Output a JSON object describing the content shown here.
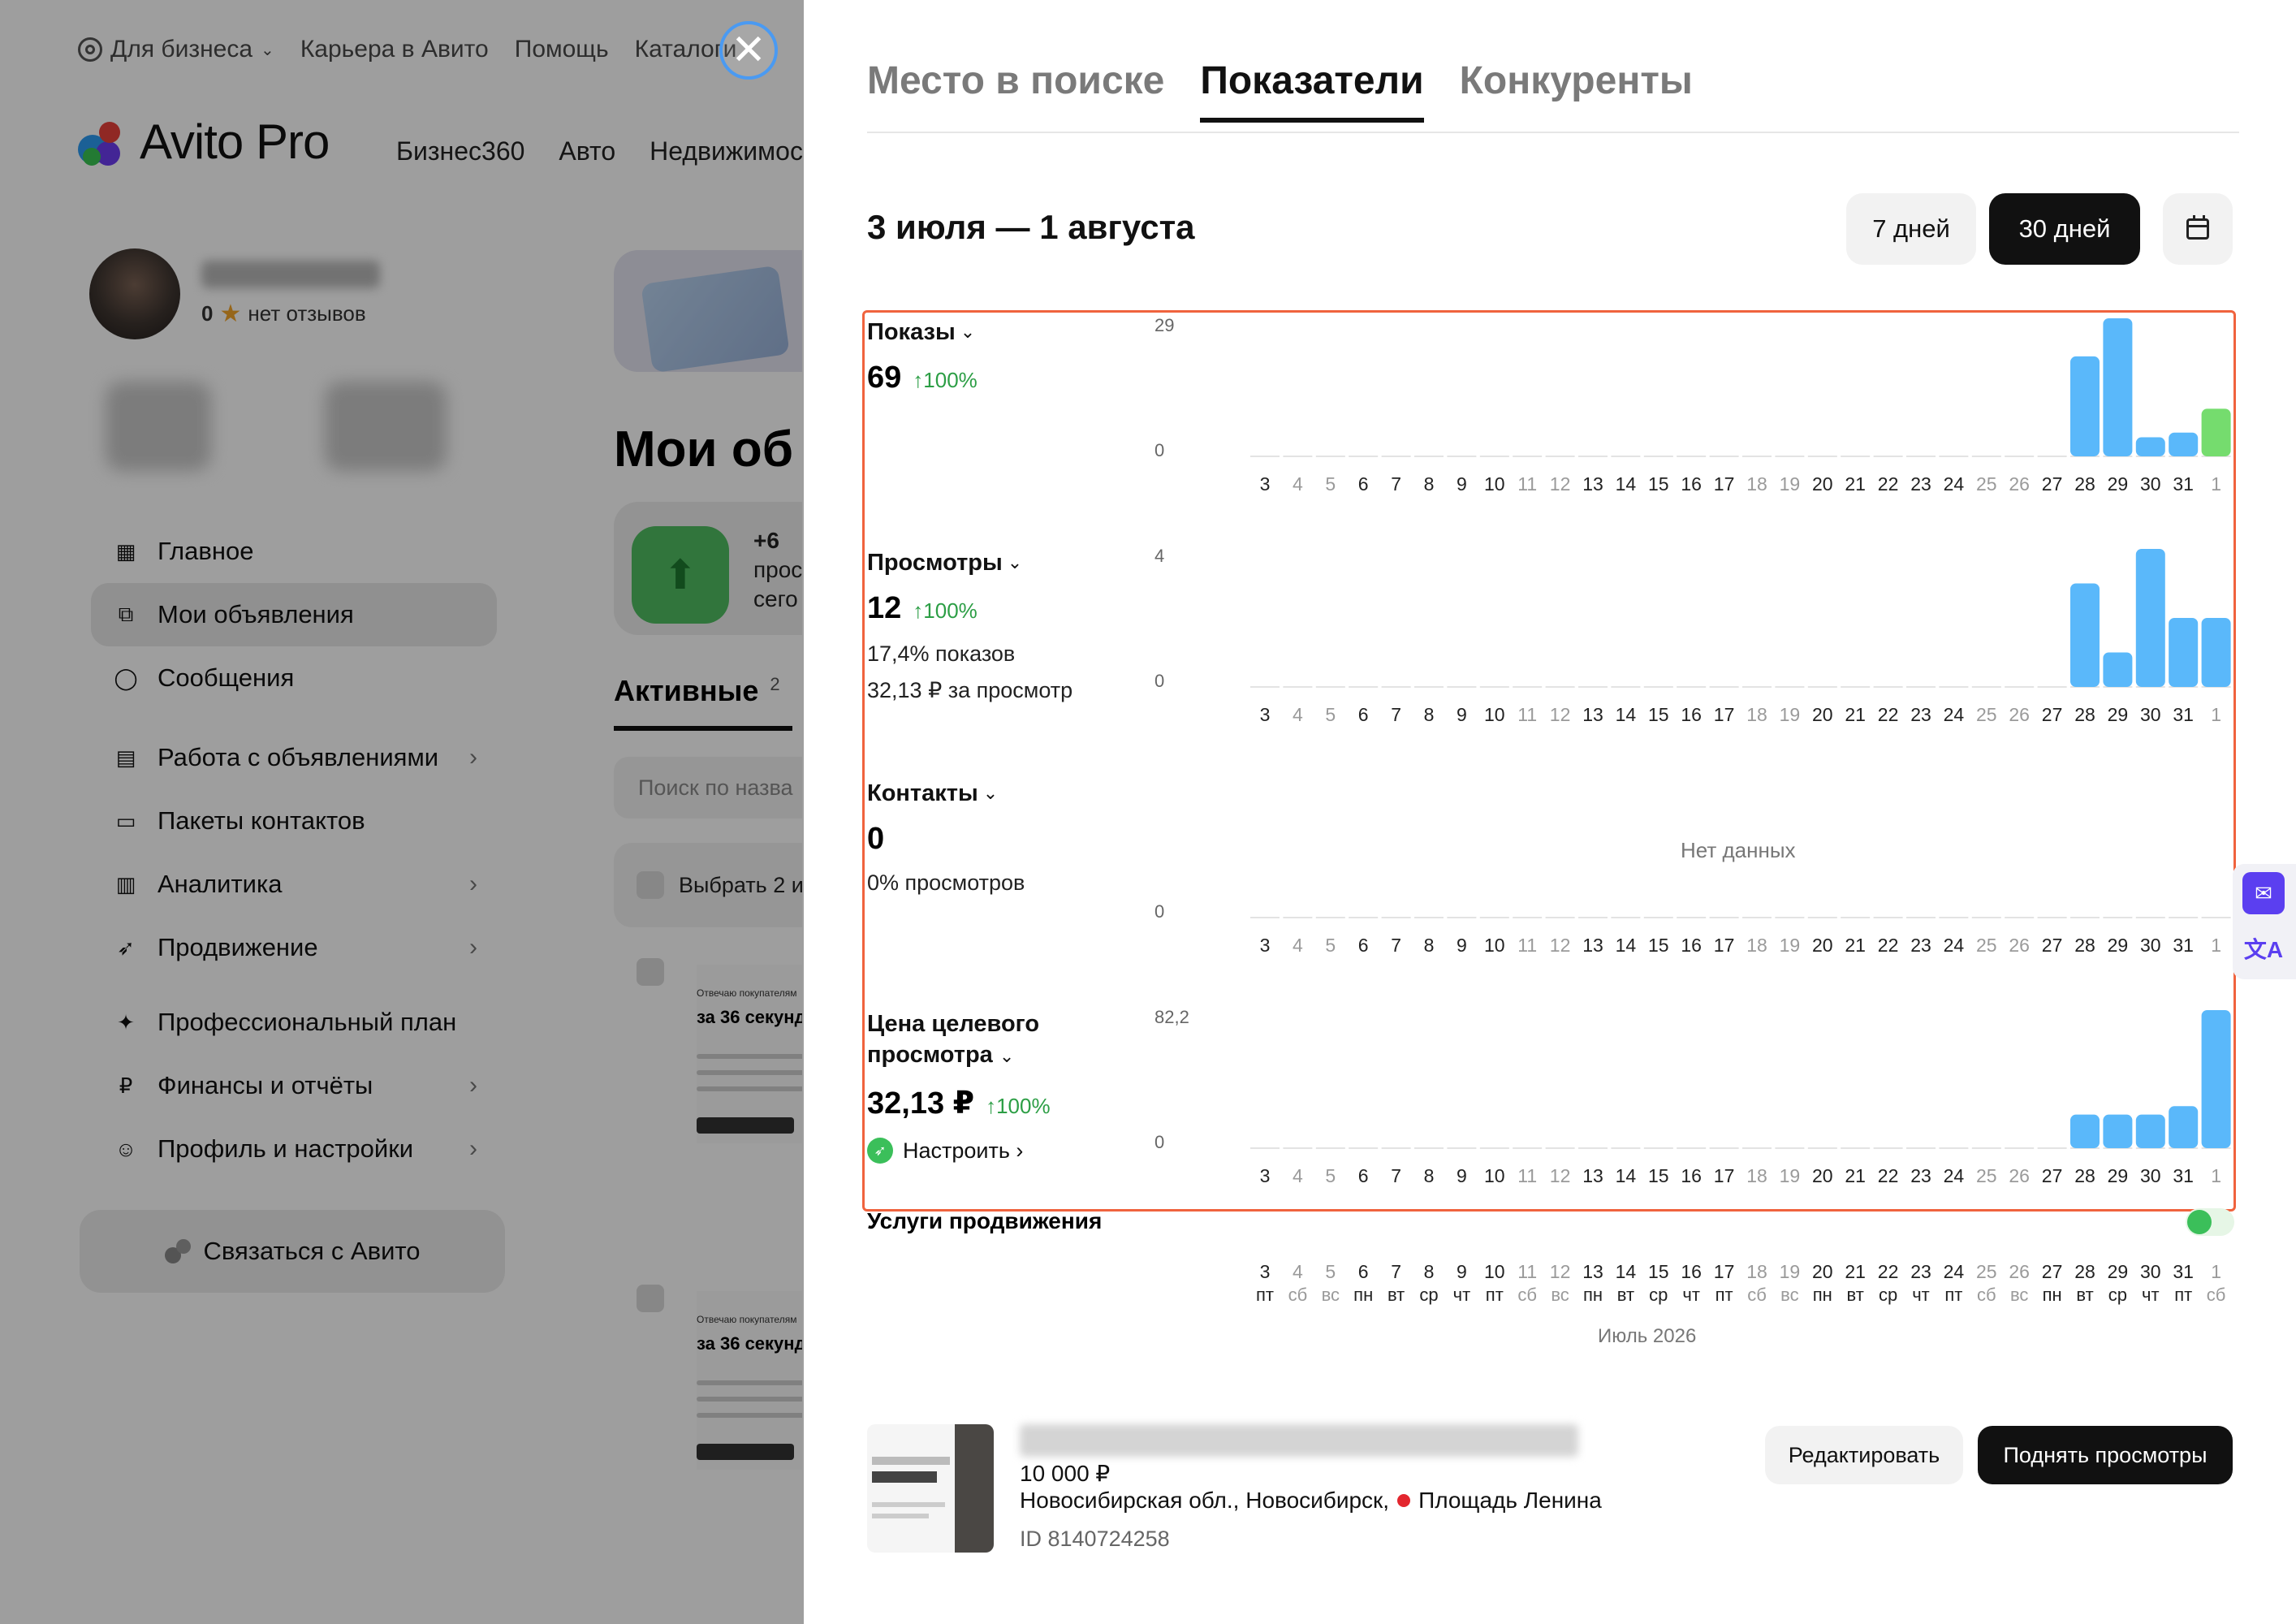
{
  "background_page": {
    "topnav": [
      "Для бизнеса",
      "Карьера в Авито",
      "Помощь",
      "Каталоги"
    ],
    "brand": "Avito Pro",
    "mainnav": [
      "Бизнес360",
      "Авто",
      "Недвижимость"
    ],
    "profile": {
      "rating": "0",
      "reviews": "нет отзывов"
    },
    "sidebar": [
      {
        "label": "Главное",
        "icon": "grid-icon",
        "chevron": false
      },
      {
        "label": "Мои объявления",
        "icon": "copy-icon",
        "chevron": false,
        "active": true
      },
      {
        "label": "Сообщения",
        "icon": "chat-icon",
        "chevron": false
      },
      {
        "label": "Работа с объявлениями",
        "icon": "list-icon",
        "chevron": true
      },
      {
        "label": "Пакеты контактов",
        "icon": "card-icon",
        "chevron": false
      },
      {
        "label": "Аналитика",
        "icon": "bar-chart-icon",
        "chevron": true
      },
      {
        "label": "Продвижение",
        "icon": "rocket-icon",
        "chevron": true
      },
      {
        "label": "Профессиональный план",
        "icon": "plan-icon",
        "chevron": false
      },
      {
        "label": "Финансы и отчёты",
        "icon": "ruble-icon",
        "chevron": true
      },
      {
        "label": "Профиль и настройки",
        "icon": "user-icon",
        "chevron": true
      }
    ],
    "contact_button": "Связаться с Авито",
    "main": {
      "title": "Мои об",
      "stat_plus": "+6",
      "stat_text_1": "прос",
      "stat_text_2": "сего",
      "tab_active": "Активные",
      "tab_count": "2",
      "search_placeholder": "Поиск по назва",
      "select_label": "Выбрать 2 и",
      "ad_thumb_title": "за 36 секунд",
      "ad_thumb_pre": "Отвечаю покупателям"
    }
  },
  "panel": {
    "tabs": [
      {
        "label": "Место в поиске",
        "active": false
      },
      {
        "label": "Показатели",
        "active": true
      },
      {
        "label": "Конкуренты",
        "active": false
      }
    ],
    "period": "3 июля — 1 августа",
    "buttons": {
      "days7": "7 дней",
      "days30": "30 дней"
    },
    "metrics": [
      {
        "name": "Показы",
        "value": "69",
        "delta": "↑100%",
        "subs": [],
        "ymax": "29",
        "ymin": "0"
      },
      {
        "name": "Просмотры",
        "value": "12",
        "delta": "↑100%",
        "subs": [
          "17,4% показов",
          "32,13 ₽ за просмотр"
        ],
        "ymax": "4",
        "ymin": "0"
      },
      {
        "name": "Контакты",
        "value": "0",
        "delta": "",
        "subs": [
          "0% просмотров"
        ],
        "ymax": "",
        "ymin": "0",
        "nodata": "Нет данных"
      },
      {
        "name_line1": "Цена целевого",
        "name_line2": "просмотра",
        "value": "32,13 ₽",
        "delta": "↑100%",
        "subs": [],
        "ymax": "82,2",
        "ymin": "0",
        "link": "Настроить ›"
      }
    ],
    "services_label": "Услуги продвижения",
    "month_label": "Июль 2026",
    "ad": {
      "price": "10 000 ₽",
      "location": "Новосибирская обл., Новосибирск,",
      "metro": "Площадь Ленина",
      "id": "ID 8140724258",
      "edit_button": "Редактировать",
      "raise_button": "Поднять просмотры"
    }
  },
  "chart_data": [
    {
      "type": "bar",
      "title": "Показы",
      "categories": [
        "3",
        "4",
        "5",
        "6",
        "7",
        "8",
        "9",
        "10",
        "11",
        "12",
        "13",
        "14",
        "15",
        "16",
        "17",
        "18",
        "19",
        "20",
        "21",
        "22",
        "23",
        "24",
        "25",
        "26",
        "27",
        "28",
        "29",
        "30",
        "31",
        "1"
      ],
      "weekdays": [
        "пт",
        "сб",
        "вс",
        "пн",
        "вт",
        "ср",
        "чт",
        "пт",
        "сб",
        "вс",
        "пн",
        "вт",
        "ср",
        "чт",
        "пт",
        "сб",
        "вс",
        "пн",
        "вт",
        "ср",
        "чт",
        "пт",
        "сб",
        "вс",
        "пн",
        "вт",
        "ср",
        "чт",
        "пт",
        "сб"
      ],
      "weekend": [
        false,
        true,
        true,
        false,
        false,
        false,
        false,
        false,
        true,
        true,
        false,
        false,
        false,
        false,
        false,
        true,
        true,
        false,
        false,
        false,
        false,
        false,
        true,
        true,
        false,
        false,
        false,
        false,
        false,
        true
      ],
      "values": [
        0,
        0,
        0,
        0,
        0,
        0,
        0,
        0,
        0,
        0,
        0,
        0,
        0,
        0,
        0,
        0,
        0,
        0,
        0,
        0,
        0,
        0,
        0,
        0,
        0,
        21,
        29,
        4,
        5,
        10
      ],
      "bar_colors": {
        "default": "#5ab8fa",
        "last": "#75dc6e"
      },
      "ylim": [
        0,
        29
      ]
    },
    {
      "type": "bar",
      "title": "Просмотры",
      "categories": [
        "3",
        "4",
        "5",
        "6",
        "7",
        "8",
        "9",
        "10",
        "11",
        "12",
        "13",
        "14",
        "15",
        "16",
        "17",
        "18",
        "19",
        "20",
        "21",
        "22",
        "23",
        "24",
        "25",
        "26",
        "27",
        "28",
        "29",
        "30",
        "31",
        "1"
      ],
      "values": [
        0,
        0,
        0,
        0,
        0,
        0,
        0,
        0,
        0,
        0,
        0,
        0,
        0,
        0,
        0,
        0,
        0,
        0,
        0,
        0,
        0,
        0,
        0,
        0,
        0,
        3,
        1,
        4,
        2,
        2
      ],
      "bar_colors": {
        "default": "#5ab8fa"
      },
      "ylim": [
        0,
        4
      ]
    },
    {
      "type": "bar",
      "title": "Контакты",
      "categories": [
        "3",
        "4",
        "5",
        "6",
        "7",
        "8",
        "9",
        "10",
        "11",
        "12",
        "13",
        "14",
        "15",
        "16",
        "17",
        "18",
        "19",
        "20",
        "21",
        "22",
        "23",
        "24",
        "25",
        "26",
        "27",
        "28",
        "29",
        "30",
        "31",
        "1"
      ],
      "values": [
        0,
        0,
        0,
        0,
        0,
        0,
        0,
        0,
        0,
        0,
        0,
        0,
        0,
        0,
        0,
        0,
        0,
        0,
        0,
        0,
        0,
        0,
        0,
        0,
        0,
        0,
        0,
        0,
        0,
        0
      ],
      "ylim": [
        0,
        1
      ]
    },
    {
      "type": "bar",
      "title": "Цена целевого просмотра",
      "categories": [
        "3",
        "4",
        "5",
        "6",
        "7",
        "8",
        "9",
        "10",
        "11",
        "12",
        "13",
        "14",
        "15",
        "16",
        "17",
        "18",
        "19",
        "20",
        "21",
        "22",
        "23",
        "24",
        "25",
        "26",
        "27",
        "28",
        "29",
        "30",
        "31",
        "1"
      ],
      "values": [
        0,
        0,
        0,
        0,
        0,
        0,
        0,
        0,
        0,
        0,
        0,
        0,
        0,
        0,
        0,
        0,
        0,
        0,
        0,
        0,
        0,
        0,
        0,
        0,
        0,
        20,
        20,
        20,
        25,
        82.2
      ],
      "bar_colors": {
        "default": "#5ab8fa"
      },
      "ylim": [
        0,
        82.2
      ]
    }
  ]
}
